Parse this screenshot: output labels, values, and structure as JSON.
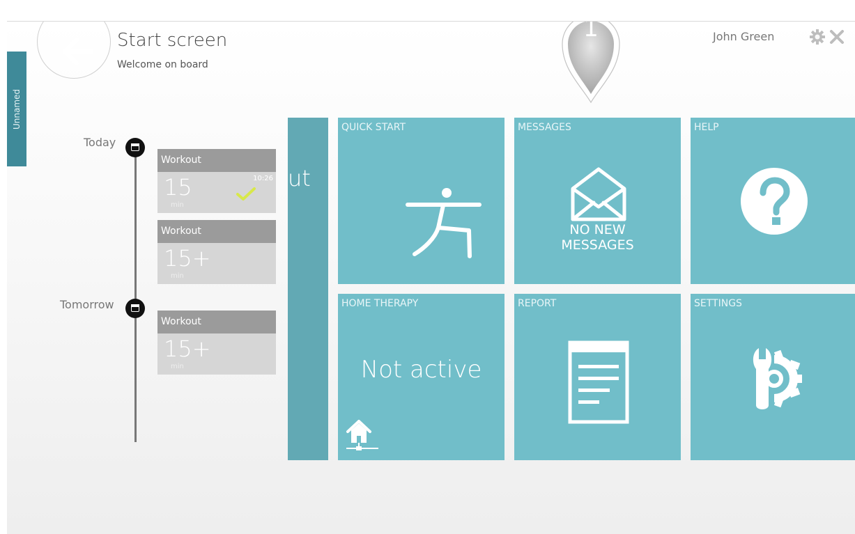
{
  "header": {
    "title": "Start screen",
    "subtitle": "Welcome on board",
    "user_name": "John Green"
  },
  "side_tab": {
    "label": "Unnamed"
  },
  "marker": {
    "number": "1"
  },
  "timeline": {
    "days": [
      {
        "label": "Today"
      },
      {
        "label": "Tomorrow"
      }
    ],
    "workouts": [
      {
        "title": "Workout",
        "duration": "15",
        "unit": "min",
        "time": "10:26",
        "completed": true
      },
      {
        "title": "Workout",
        "duration": "15+",
        "unit": "min"
      },
      {
        "title": "Workout",
        "duration": "15+",
        "unit": "min"
      }
    ]
  },
  "partial_tile": {
    "text": "ut"
  },
  "tiles": {
    "quick_start": {
      "label": "QUICK START",
      "icon": "yoga-pose-icon"
    },
    "messages": {
      "label": "MESSAGES",
      "icon": "envelope-icon",
      "status_line1": "NO NEW",
      "status_line2": "MESSAGES"
    },
    "help": {
      "label": "HELP",
      "icon": "question-icon"
    },
    "home_therapy": {
      "label": "HOME THERAPY",
      "status": "Not active",
      "icon": "home-network-icon"
    },
    "report": {
      "label": "REPORT",
      "icon": "document-icon"
    },
    "settings": {
      "label": "SETTINGS",
      "icon": "wrench-gear-icon"
    }
  },
  "colors": {
    "tile": "#71bec9",
    "partial_tile": "#62a9b4",
    "side_tab": "#3f8a99",
    "card_header": "#9b9b9b",
    "card_body": "#d6d6d6",
    "check": "#d8e84a"
  }
}
